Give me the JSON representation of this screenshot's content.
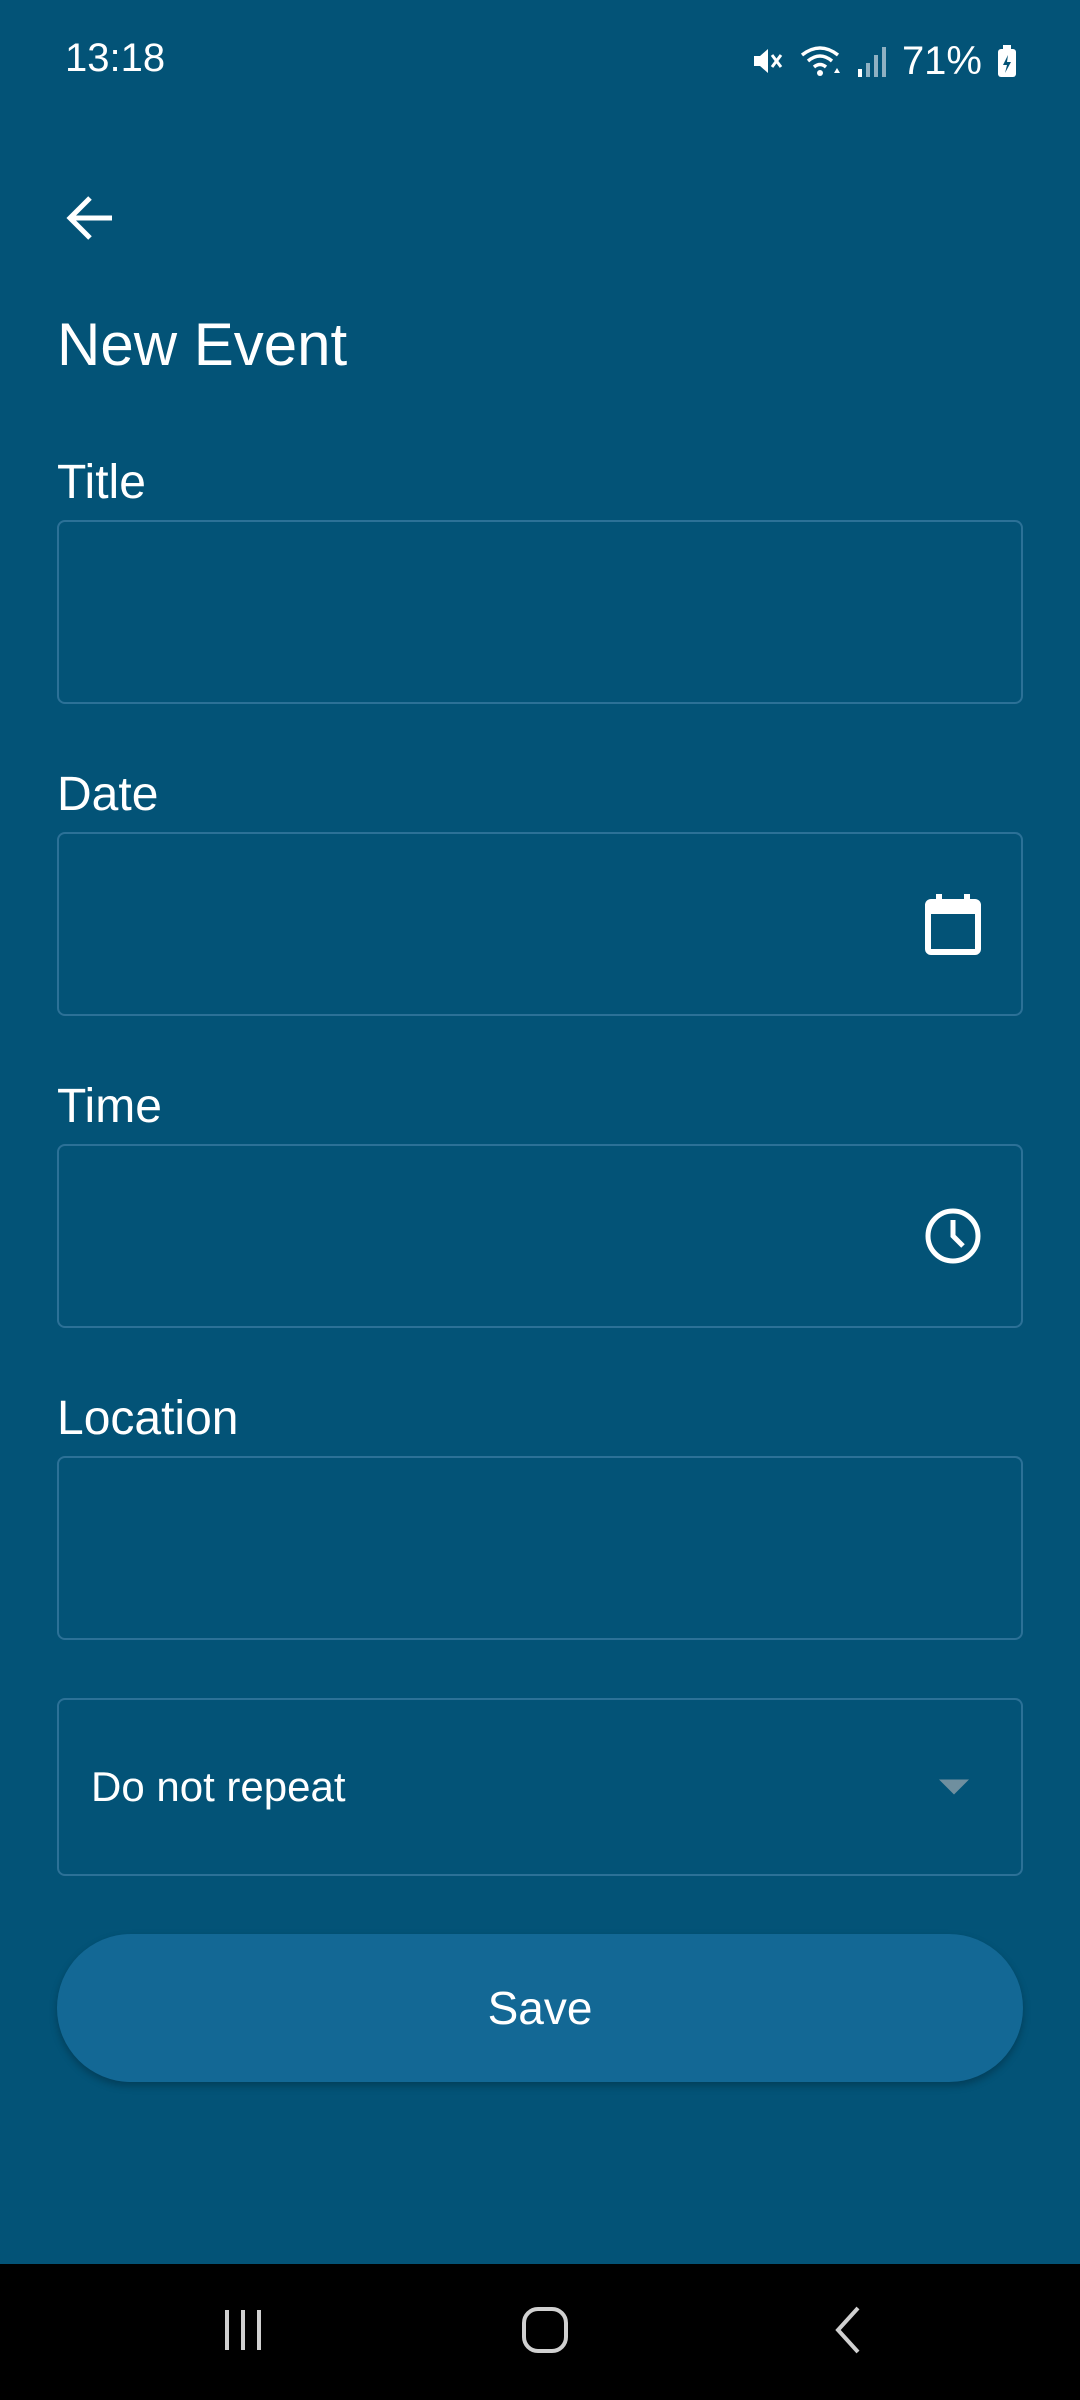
{
  "status_bar": {
    "time": "13:18",
    "battery_percent": "71%",
    "icons": [
      "mute-icon",
      "wifi-icon",
      "signal-icon",
      "battery-icon"
    ]
  },
  "header": {
    "back_icon": "arrow-left-icon",
    "title": "New Event"
  },
  "form": {
    "title": {
      "label": "Title",
      "value": "",
      "placeholder": ""
    },
    "date": {
      "label": "Date",
      "value": "",
      "placeholder": "",
      "icon": "calendar-icon"
    },
    "time": {
      "label": "Time",
      "value": "",
      "placeholder": "",
      "icon": "clock-icon"
    },
    "location": {
      "label": "Location",
      "value": "",
      "placeholder": ""
    },
    "repeat": {
      "selected": "Do not repeat",
      "icon": "chevron-down-icon"
    },
    "save_label": "Save"
  },
  "nav_bar": {
    "icons": [
      "recents-icon",
      "home-icon",
      "back-icon"
    ]
  },
  "colors": {
    "background": "#035377",
    "field_border": "#2c7197",
    "button": "#136895",
    "nav_bar": "#000000"
  }
}
